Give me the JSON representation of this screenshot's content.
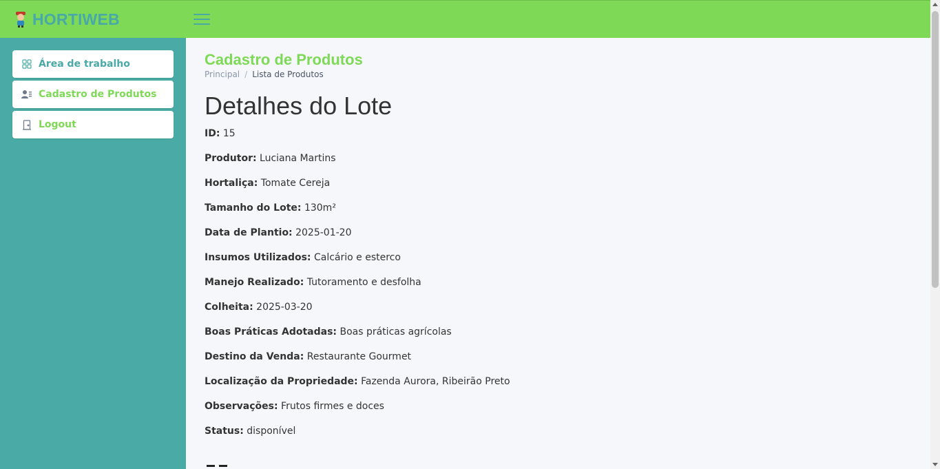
{
  "brand": {
    "name": "HORTIWEB",
    "icon": "farmer-logo-icon"
  },
  "header": {
    "menu_icon": "hamburger-menu-icon"
  },
  "sidebar": {
    "items": [
      {
        "label": "Área de trabalho",
        "icon": "dashboard-grid-icon",
        "color": "#48a9a6"
      },
      {
        "label": "Cadastro de Produtos",
        "icon": "user-list-icon",
        "color": "#7ed957"
      },
      {
        "label": "Logout",
        "icon": "door-icon",
        "color": "#7ed957"
      }
    ]
  },
  "page": {
    "title": "Cadastro de Produtos",
    "breadcrumb": {
      "home": "Principal",
      "separator": "/",
      "current": "Lista de Produtos"
    },
    "heading": "Detalhes do Lote"
  },
  "details": [
    {
      "label": "ID:",
      "value": "15"
    },
    {
      "label": "Produtor:",
      "value": "Luciana Martins"
    },
    {
      "label": "Hortaliça:",
      "value": "Tomate Cereja"
    },
    {
      "label": "Tamanho do Lote:",
      "value": "130m²"
    },
    {
      "label": "Data de Plantio:",
      "value": "2025-01-20"
    },
    {
      "label": "Insumos Utilizados:",
      "value": "Calcário e esterco"
    },
    {
      "label": "Manejo Realizado:",
      "value": "Tutoramento e desfolha"
    },
    {
      "label": "Colheita:",
      "value": "2025-03-20"
    },
    {
      "label": "Boas Práticas Adotadas:",
      "value": "Boas práticas agrícolas"
    },
    {
      "label": "Destino da Venda:",
      "value": "Restaurante Gourmet"
    },
    {
      "label": "Localização da Propriedade:",
      "value": "Fazenda Aurora, Ribeirão Preto"
    },
    {
      "label": "Observações:",
      "value": "Frutos firmes e doces"
    },
    {
      "label": "Status:",
      "value": "disponível"
    }
  ],
  "colors": {
    "header_bg": "#7ed957",
    "sidebar_bg": "#4aaba6",
    "brand_text": "#48a9a6",
    "title_green": "#7ed957",
    "content_bg": "#f5f7fb"
  }
}
